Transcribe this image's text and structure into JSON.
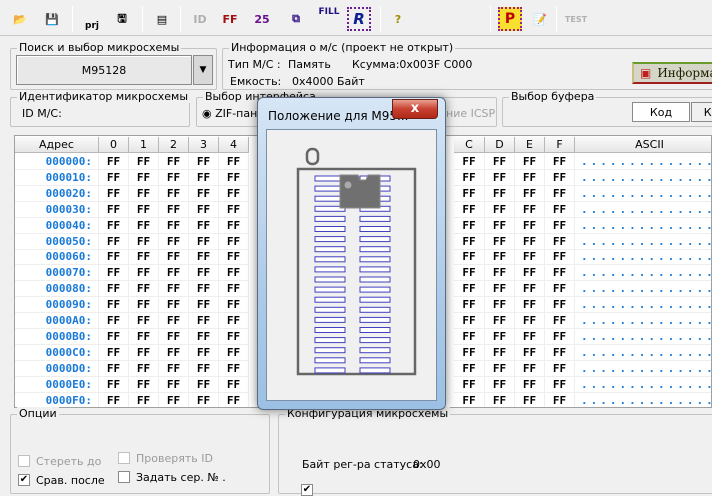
{
  "toolbar": {
    "icons": [
      "open-icon",
      "save-icon",
      "open-project-icon",
      "save-project-icon",
      "chip-calc-icon",
      "id-icon",
      "fill-ff-icon",
      "fill-25-icon",
      "blank-check-icon",
      "fill-icon",
      "read-icon",
      "help-icon",
      "program-icon",
      "edit-icon",
      "test-icon"
    ],
    "labels": {
      "prj": "prj",
      "fill": "FILL",
      "r": "R",
      "ff": "FF",
      "n25": "25",
      "help": "?",
      "p": "P",
      "test": "TEST",
      "id": "ID"
    }
  },
  "search": {
    "title": "Поиск и выбор микросхемы",
    "chip": "M95128"
  },
  "info": {
    "title": "Информация о м/с (проект не открыт)",
    "type_label": "Тип М/С :",
    "type_value": "Память",
    "checksum": "Ксумма:0x003F C000",
    "capacity_label": "Емкость:",
    "capacity_value": "0x4000 Байт",
    "info_button": "Информа"
  },
  "ident": {
    "title": "Идентификатор микросхемы",
    "id_label": "ID М/С:"
  },
  "interface": {
    "title": "Выбор интерфейса",
    "zif": "ZIF-пан",
    "icsp": "ние ICSP"
  },
  "buffer": {
    "title": "Выбор буфера",
    "code": "Код",
    "second": "Ко"
  },
  "table": {
    "headers": [
      "Адрес",
      "0",
      "1",
      "2",
      "3",
      "4",
      "C",
      "D",
      "E",
      "F",
      "ASCII"
    ],
    "rows": [
      "000000:",
      "000010:",
      "000020:",
      "000030:",
      "000040:",
      "000050:",
      "000060:",
      "000070:",
      "000080:",
      "000090:",
      "0000A0:",
      "0000B0:",
      "0000C0:",
      "0000D0:",
      "0000E0:",
      "0000F0:"
    ],
    "value": "FF",
    "ascii": "................"
  },
  "options": {
    "title": "Опции",
    "erase": "Стереть до",
    "verify_id": "Проверять ID",
    "compare": "Срав. после",
    "serial": "Задать сер. №  ."
  },
  "config": {
    "title": "Конфигурация микросхемы",
    "status": "Байт рег-ра статуса:",
    "status_value": "0x00"
  },
  "dialog": {
    "title": "Положение для M95...",
    "close": "x",
    "pins_per_side": 20,
    "chip_pins_per_side": 4,
    "pin_color": "#4040c0",
    "chip_color": "#707070"
  }
}
